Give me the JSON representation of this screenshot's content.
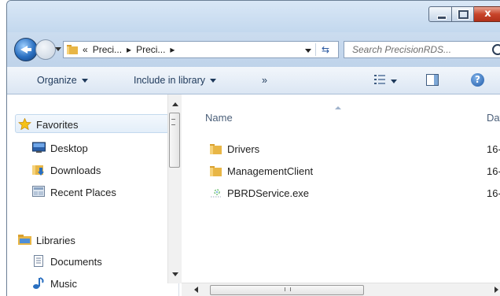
{
  "window": {
    "minimize_icon": "minimize-icon",
    "maximize_icon": "maximize-icon",
    "close_glyph": "x"
  },
  "navigation": {
    "breadcrumb_prefix": "«",
    "crumbs": [
      "Preci...",
      "Preci..."
    ],
    "separator": "▸",
    "search_placeholder": "Search PrecisionRDS..."
  },
  "toolbar": {
    "organize_label": "Organize",
    "include_label": "Include in library",
    "more_label": "»",
    "help_glyph": "?"
  },
  "sidebar": {
    "items": [
      {
        "label": "Favorites",
        "icon": "star-icon"
      },
      {
        "label": "Desktop",
        "icon": "desktop-icon"
      },
      {
        "label": "Downloads",
        "icon": "downloads-folder-icon"
      },
      {
        "label": "Recent Places",
        "icon": "recent-places-icon"
      },
      {
        "label": "Libraries",
        "icon": "libraries-icon"
      },
      {
        "label": "Documents",
        "icon": "document-icon"
      },
      {
        "label": "Music",
        "icon": "music-note-icon"
      }
    ]
  },
  "files": {
    "columns": {
      "name": "Name",
      "date": "Dat"
    },
    "rows": [
      {
        "name": "Drivers",
        "date": "16-",
        "icon": "folder-icon"
      },
      {
        "name": "ManagementClient",
        "date": "16-",
        "icon": "folder-icon"
      },
      {
        "name": "PBRDService.exe",
        "date": "16-",
        "icon": "executable-icon"
      }
    ]
  },
  "colors": {
    "accent": "#1e395b",
    "folder": "#e8b646",
    "close_button": "#c8442a"
  }
}
